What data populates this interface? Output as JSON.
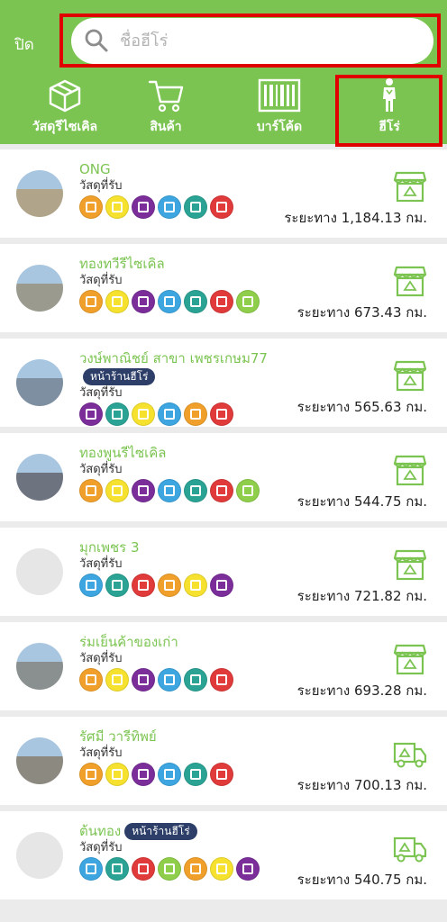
{
  "header": {
    "close_label": "ปิด",
    "search_placeholder": "ชื่อฮีโร่",
    "search_value": "",
    "tabs": [
      {
        "label": "วัสดุรีไซเคิล",
        "icon": "box-icon"
      },
      {
        "label": "สินค้า",
        "icon": "cart-icon"
      },
      {
        "label": "บาร์โค้ด",
        "icon": "barcode-icon"
      },
      {
        "label": "ฮีโร่",
        "icon": "hero-icon",
        "active": true
      }
    ]
  },
  "colors": {
    "brand": "#7cc452",
    "highlight": "#e00000",
    "badge": "#2d3f68",
    "materials": {
      "paper": "#f0a02a",
      "plastic-bottle-yellow": "#f5e12e",
      "can": "#7b2e9a",
      "plastic-bottle-blue": "#3da6e0",
      "electronics": "#2aa395",
      "steel": "#e03a3a",
      "fabric": "#8fce4a"
    }
  },
  "list": {
    "materials_label": "วัสดุที่รับ",
    "items": [
      {
        "name": "ONG",
        "badge": "",
        "distance": "ระยะทาง 1,184.13 กม.",
        "shop_type": "store-icon",
        "materials": [
          "paper",
          "plastic-bottle-yellow",
          "can",
          "plastic-bottle-blue",
          "electronics",
          "steel"
        ]
      },
      {
        "name": "ทองทวีรีไซเคิล",
        "badge": "",
        "distance": "ระยะทาง 673.43 กม.",
        "shop_type": "store-icon",
        "materials": [
          "paper",
          "plastic-bottle-yellow",
          "can",
          "plastic-bottle-blue",
          "electronics",
          "steel",
          "fabric"
        ]
      },
      {
        "name": "วงษ์พาณิชย์ สาขา เพชรเกษม77",
        "badge": "หน้าร้านฮีโร่",
        "distance": "ระยะทาง 565.63 กม.",
        "shop_type": "store-icon",
        "materials": [
          "can",
          "electronics",
          "plastic-bottle-yellow",
          "plastic-bottle-blue",
          "paper",
          "steel"
        ]
      },
      {
        "name": "ทองพูนรีไซเคิล",
        "badge": "",
        "distance": "ระยะทาง 544.75 กม.",
        "shop_type": "store-icon",
        "materials": [
          "paper",
          "plastic-bottle-yellow",
          "can",
          "plastic-bottle-blue",
          "electronics",
          "steel",
          "fabric"
        ]
      },
      {
        "name": "มุกเพชร 3",
        "badge": "",
        "distance": "ระยะทาง 721.82 กม.",
        "shop_type": "store-icon",
        "materials": [
          "plastic-bottle-blue",
          "electronics",
          "steel",
          "paper",
          "plastic-bottle-yellow",
          "can"
        ]
      },
      {
        "name": "ร่มเย็นค้าของเก่า",
        "badge": "",
        "distance": "ระยะทาง 693.28 กม.",
        "shop_type": "store-icon",
        "materials": [
          "paper",
          "plastic-bottle-yellow",
          "can",
          "plastic-bottle-blue",
          "electronics",
          "steel"
        ]
      },
      {
        "name": "รัศมี วารีทิพย์",
        "badge": "",
        "distance": "ระยะทาง 700.13 กม.",
        "shop_type": "truck-icon",
        "materials": [
          "paper",
          "plastic-bottle-yellow",
          "can",
          "plastic-bottle-blue",
          "electronics",
          "steel"
        ]
      },
      {
        "name": "ต้นทอง",
        "badge": "หน้าร้านฮีโร่",
        "distance": "ระยะทาง 540.75 กม.",
        "shop_type": "truck-icon",
        "materials": [
          "plastic-bottle-blue",
          "electronics",
          "steel",
          "fabric",
          "paper",
          "plastic-bottle-yellow",
          "can"
        ]
      }
    ]
  }
}
